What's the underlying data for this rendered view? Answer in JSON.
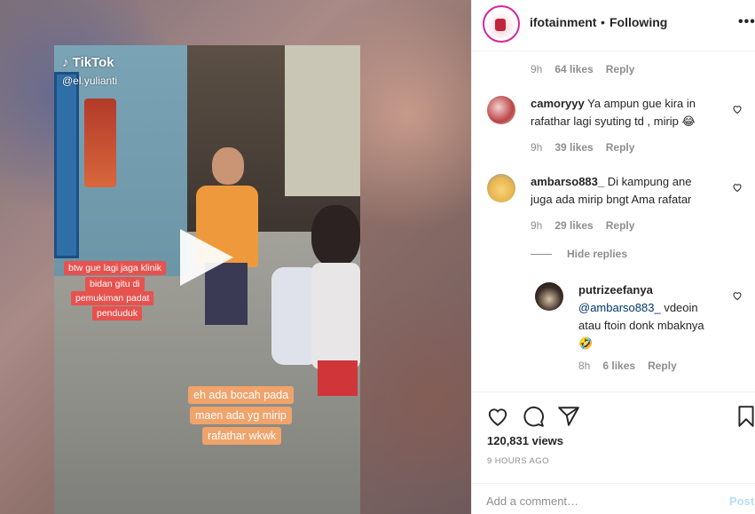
{
  "media": {
    "watermark": "TikTok",
    "watermark_user": "@el.yulianti",
    "caption_red": [
      "btw gue lagi jaga klinik",
      "bidan gitu di",
      "pemukiman padat",
      "penduduk"
    ],
    "caption_orange": [
      "eh ada bocah pada",
      "maen ada yg mirip",
      "rafathar wkwk"
    ],
    "play_icon": "play-icon"
  },
  "header": {
    "username": "ifotainment",
    "dot": "•",
    "follow_status": "Following",
    "more_icon": "•••"
  },
  "comments": [
    {
      "time": "9h",
      "likes": "64 likes",
      "reply": "Reply"
    },
    {
      "username": "camoryyy",
      "text_line1": "Ya ampun gue kira in",
      "text_line2": "rafathar lagi syuting td , mirip 😂",
      "time": "9h",
      "likes": "39 likes",
      "reply": "Reply"
    },
    {
      "username": "ambarso883_",
      "text_line1": "Di kampung ane",
      "text_line2": "juga ada mirip bngt Ama rafatar",
      "time": "9h",
      "likes": "29 likes",
      "reply": "Reply"
    }
  ],
  "hide_replies": "Hide replies",
  "reply": {
    "username": "putrizeefanya",
    "mention": "@ambarso883_",
    "text_line1": " vdeoin",
    "text_line2": "atau ftoin donk mbaknya",
    "text_line3": "🤣",
    "time": "8h",
    "likes": "6 likes",
    "reply": "Reply"
  },
  "stats": {
    "views": "120,831 views",
    "time_ago": "9 HOURS AGO"
  },
  "composer": {
    "placeholder": "Add a comment…",
    "post_label": "Post"
  },
  "colors": {
    "accent_blue": "#0095f6",
    "post_disabled": "#b2dffc",
    "muted": "#8e8e8e"
  }
}
